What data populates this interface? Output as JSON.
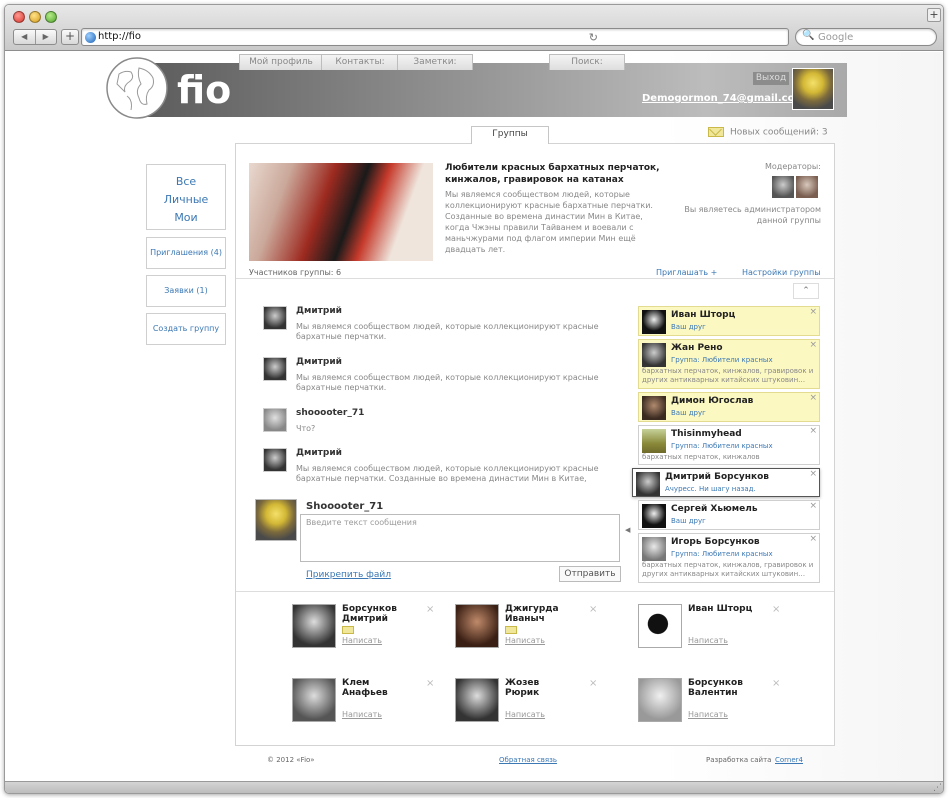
{
  "browser": {
    "url": "http://fio",
    "search_placeholder": "Google",
    "back": "◀",
    "forward": "▶",
    "add_tab": "+",
    "new_tab": "+"
  },
  "header": {
    "logo": "fio",
    "logout": "Выход",
    "email": "Demogormon_74@gmail.com"
  },
  "tabs": [
    "Мой профиль",
    "Контакты:",
    "Заметки:",
    "Группы",
    "Поиск:"
  ],
  "messages_indicator": "Новых сообщений: 3",
  "sidebar": {
    "filters": [
      "Все",
      "Личные",
      "Мои"
    ],
    "invitations": "Приглашения (4)",
    "requests": "Заявки (1)",
    "create_group": "Создать группу"
  },
  "group": {
    "title": "Любители красных бархатных перчаток, кинжалов, гравировок на катанах",
    "description": "Мы являемся сообществом людей, которые коллекционируют красные бархатные перчатки. Созданные во времена династии Мин в Китае, когда Чжэны правили Тайванем и воевали с маньчжурами под флагом империи Мин ещё двадцать лет.",
    "moderators_label": "Модераторы:",
    "admin_note": "Вы являетесь администратором данной группы",
    "members_count": "Участников группы: 6",
    "invite": "Приглашать +",
    "settings": "Настройки группы"
  },
  "chat": [
    {
      "name": "Дмитрий",
      "text": "Мы являемся сообществом людей, которые коллекционируют красные бархатные перчатки."
    },
    {
      "name": "Дмитрий",
      "text": "Мы являемся сообществом людей, которые коллекционируют красные бархатные перчатки."
    },
    {
      "name": "shooooter_71",
      "text": "Что?"
    },
    {
      "name": "Дмитрий",
      "text": "Мы являемся сообществом людей, которые коллекционируют красные бархатные перчатки. Созданные во времена династии Мин в Китае, когда"
    }
  ],
  "composer": {
    "name": "Shooooter_71",
    "placeholder": "Введите текст сообщения",
    "attach": "Прикрепить файл",
    "send": "Отправить"
  },
  "friends": [
    {
      "name": "Иван Шторц",
      "sub": "Ваш друг",
      "desc": ""
    },
    {
      "name": "Жан Рено",
      "sub": "Группа: Любители красных",
      "desc": "бархатных перчаток, кинжалов, гравировок и других антикварных китайских штуковин…"
    },
    {
      "name": "Димон Югослав",
      "sub": "Ваш друг",
      "desc": ""
    },
    {
      "name": "Thisinmyhead",
      "sub": "Группа: Любители красных",
      "desc": "бархатных перчаток, кинжалов"
    },
    {
      "name": "Дмитрий Борсунков",
      "sub": "Ачуресс. Ни шагу назад.",
      "desc": ""
    },
    {
      "name": "Сергей Хьюмель",
      "sub": "Ваш друг",
      "desc": ""
    },
    {
      "name": "Игорь Борсунков",
      "sub": "Группа: Любители красных",
      "desc": "бархатных перчаток, кинжалов, гравировок и других антикварных китайских штуковин…"
    }
  ],
  "members": [
    {
      "name": "Борсунков Дмитрий",
      "write": "Написать",
      "has_mail": true
    },
    {
      "name": "Джигурда Иваныч",
      "write": "Написать",
      "has_mail": true
    },
    {
      "name": "Иван Шторц",
      "write": "Написать",
      "has_mail": false
    },
    {
      "name": "Клем Анафьев",
      "write": "Написать",
      "has_mail": false
    },
    {
      "name": "Жозев Рюрик",
      "write": "Написать",
      "has_mail": false
    },
    {
      "name": "Борсунков Валентин",
      "write": "Написать",
      "has_mail": false
    }
  ],
  "close": "×",
  "footer": {
    "copyright": "© 2012 «Fio»",
    "feedback": "Обратная связь",
    "dev_label": "Разработка сайта",
    "dev_link": "Corner4"
  }
}
